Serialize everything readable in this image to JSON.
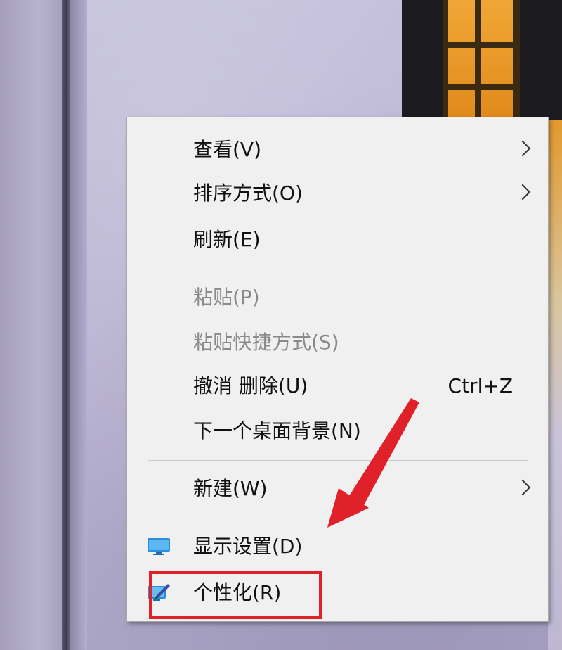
{
  "context_menu": {
    "items": [
      {
        "label": "查看(V)",
        "has_submenu": true,
        "enabled": true
      },
      {
        "label": "排序方式(O)",
        "has_submenu": true,
        "enabled": true
      },
      {
        "label": "刷新(E)",
        "has_submenu": false,
        "enabled": true
      },
      {
        "label": "粘贴(P)",
        "has_submenu": false,
        "enabled": false
      },
      {
        "label": "粘贴快捷方式(S)",
        "has_submenu": false,
        "enabled": false
      },
      {
        "label": "撤消 删除(U)",
        "shortcut": "Ctrl+Z",
        "has_submenu": false,
        "enabled": true
      },
      {
        "label": "下一个桌面背景(N)",
        "has_submenu": false,
        "enabled": true
      },
      {
        "label": "新建(W)",
        "has_submenu": true,
        "enabled": true
      },
      {
        "label": "显示设置(D)",
        "icon": "display-settings-icon",
        "has_submenu": false,
        "enabled": true
      },
      {
        "label": "个性化(R)",
        "icon": "personalize-icon",
        "has_submenu": false,
        "enabled": true,
        "highlighted_by_annotation": true
      }
    ]
  },
  "annotation": {
    "color": "#e0212a",
    "arrow_icon": "red-arrow-pointer"
  },
  "colors": {
    "menu_background": "#f0f0f0",
    "disabled_text": "#8a8a8a",
    "highlight_red": "#e0212a"
  }
}
